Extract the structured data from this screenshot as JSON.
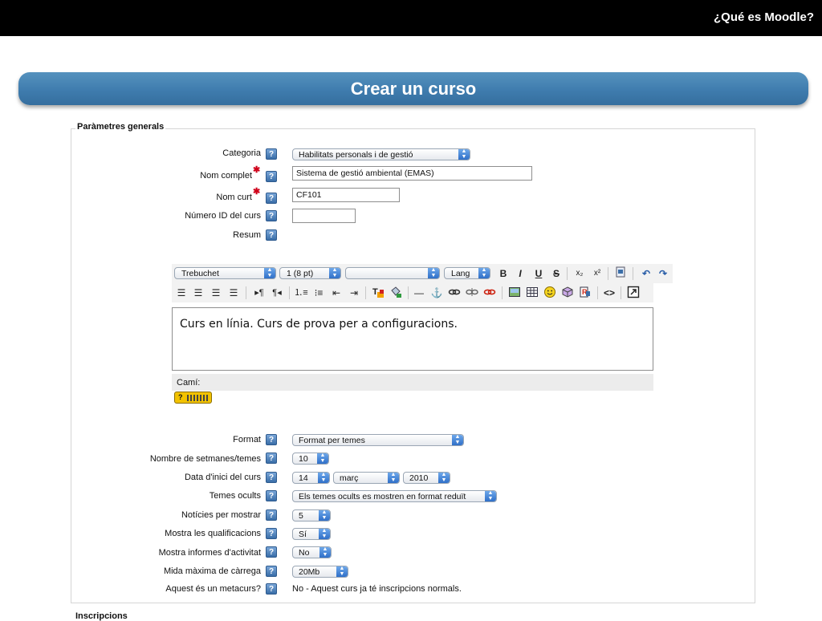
{
  "header": {
    "title": "¿Qué es Moodle?"
  },
  "banner": {
    "title": "Crear un curso"
  },
  "fieldset": {
    "legend": "Paràmetres generals"
  },
  "fields": {
    "categoria": {
      "label": "Categoria",
      "value": "Habilitats personals i de gestió"
    },
    "nom_complet": {
      "label": "Nom complet",
      "value": "Sistema de gestió ambiental (EMAS)"
    },
    "nom_curt": {
      "label": "Nom curt",
      "value": "CF101"
    },
    "numero_id": {
      "label": "Número ID del curs",
      "value": ""
    },
    "resum": {
      "label": "Resum"
    },
    "format": {
      "label": "Format",
      "value": "Format per temes"
    },
    "setmanes": {
      "label": "Nombre de setmanes/temes",
      "value": "10"
    },
    "data_inici": {
      "label": "Data d'inici del curs",
      "day": "14",
      "month": "març",
      "year": "2010"
    },
    "temes_ocults": {
      "label": "Temes ocults",
      "value": "Els temes ocults es mostren en format reduït"
    },
    "noticies": {
      "label": "Notícies per mostrar",
      "value": "5"
    },
    "qualificacions": {
      "label": "Mostra les qualificacions",
      "value": "Sí"
    },
    "informes": {
      "label": "Mostra informes d'activitat",
      "value": "No"
    },
    "carrega": {
      "label": "Mida màxima de càrrega",
      "value": "20Mb"
    },
    "metacurs": {
      "label": "Aquest és un metacurs?",
      "value": "No - Aquest curs ja té inscripcions normals."
    }
  },
  "editor": {
    "font": "Trebuchet",
    "size": "1 (8 pt)",
    "style": "",
    "lang": "Lang",
    "content": "Curs en línia. Curs de prova per a configuracions.",
    "path_label": "Camí:"
  },
  "help_glyph": "?",
  "next_section": "Inscripcions"
}
